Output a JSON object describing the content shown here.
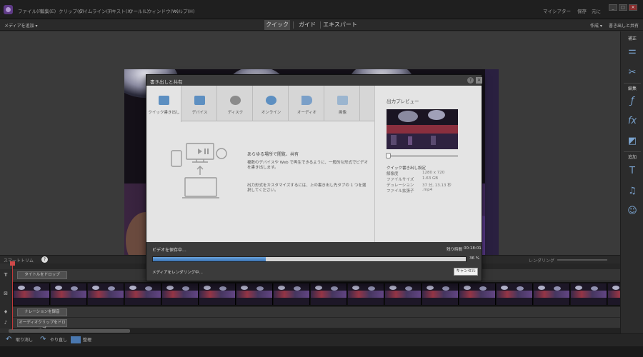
{
  "menu": [
    "ファイル(F)",
    "編集(E)",
    "クリップ(C)",
    "タイムライン(T)",
    "テキスト(X)",
    "ツール(L)",
    "ウィンドウ(W)",
    "ヘルプ(H)"
  ],
  "menu_right": [
    "マイシアター",
    "保存",
    "元に"
  ],
  "window_buttons": [
    "_",
    "□",
    "×"
  ],
  "add_media_label": "メディアを追加 ▾",
  "modes": {
    "quick": "クイック",
    "guide": "ガイド",
    "expert": "エキスパート"
  },
  "create_label": "作成 ▾",
  "export_share_label": "書き出しと共有",
  "right_panel": {
    "adjust": "補正",
    "edit": "編集",
    "add": "追加",
    "icons": [
      "sliders-icon",
      "tools-icon",
      "fx-guide-icon",
      "fx-icon",
      "transition-icon",
      "title-icon",
      "music-icon",
      "smiley-icon"
    ]
  },
  "dialog": {
    "title": "書き出しと共有",
    "help": "?",
    "close": "×",
    "tabs": [
      {
        "label": "クイック書き出し",
        "icon": "quick-export-icon",
        "active": true
      },
      {
        "label": "デバイス",
        "icon": "device-icon"
      },
      {
        "label": "ディスク",
        "icon": "disc-icon"
      },
      {
        "label": "オンライン",
        "icon": "globe-icon"
      },
      {
        "label": "オーディオ",
        "icon": "speaker-icon"
      },
      {
        "label": "画像",
        "icon": "image-icon"
      }
    ],
    "desc1": "あらゆる場所で閲覧、共有",
    "desc2": "複数のデバイスや Web で再生できるように、一般的な形式でビデオを書き出します。",
    "desc3": "出力形式をカスタマイズするには、上の書き出し先タブの 1 つを選択してください。",
    "output_preview": "出力プレビュー",
    "settings_title": "クイック書き出し設定",
    "settings": [
      {
        "key": "解像度",
        "value": "1280 x 720"
      },
      {
        "key": "ファイルサイズ",
        "value": "1.63 GB"
      },
      {
        "key": "デュレーション",
        "value": "37 分, 13.13 秒"
      },
      {
        "key": "ファイル拡張子",
        "value": ".mp4"
      }
    ],
    "saving": "ビデオを保存中...",
    "remaining_label": "残り時間",
    "remaining_value": "00:18:01",
    "progress": 0.36,
    "progress_text": "36 %",
    "rendering": "メディアをレンダリング中...",
    "cancel": "キャンセル"
  },
  "timeline": {
    "toolbar_label": "スマートトリム",
    "help": "?",
    "render_label": "レンダリング",
    "title_drop": "タイトルをドロップ",
    "narration": "ナレーションを録音",
    "audio_drop": "オーディオクリップをドロップ",
    "track_T": "T"
  },
  "bottom": {
    "undo": "取り消し",
    "redo": "やり直し",
    "organizer": "整理"
  }
}
